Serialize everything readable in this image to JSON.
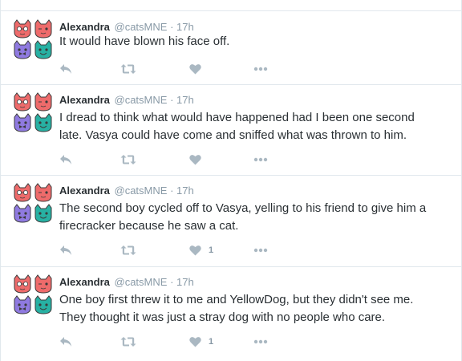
{
  "colors": {
    "icon": "#aab8c2",
    "muted": "#8899a6",
    "text": "#292f33",
    "cat_red": "#ee6b6b",
    "cat_purple": "#8f7ae0",
    "cat_teal": "#27b1a3"
  },
  "tweets": [
    {
      "name": "Alexandra",
      "handle": "@catsMNE",
      "separator": "·",
      "time": "17h",
      "lines": [
        "It would have blown his face off."
      ],
      "likes": ""
    },
    {
      "name": "Alexandra",
      "handle": "@catsMNE",
      "separator": "·",
      "time": "17h",
      "lines": [
        "I dread to think what would have happened had I been one second",
        "late. Vasya could have come and sniffed what was thrown to him."
      ],
      "likes": ""
    },
    {
      "name": "Alexandra",
      "handle": "@catsMNE",
      "separator": "·",
      "time": "17h",
      "lines": [
        "The second boy cycled off to Vasya, yelling to his friend to give him a",
        "firecracker because he saw a cat."
      ],
      "likes": "1"
    },
    {
      "name": "Alexandra",
      "handle": "@catsMNE",
      "separator": "·",
      "time": "17h",
      "lines": [
        "One boy first threw it to me and YellowDog, but they didn't see me.",
        "They thought it was just a stray dog with no people who care."
      ],
      "likes": "1"
    }
  ],
  "icons": {
    "reply": "reply-icon",
    "retweet": "retweet-icon",
    "like": "heart-icon",
    "more": "more-dots-icon"
  }
}
